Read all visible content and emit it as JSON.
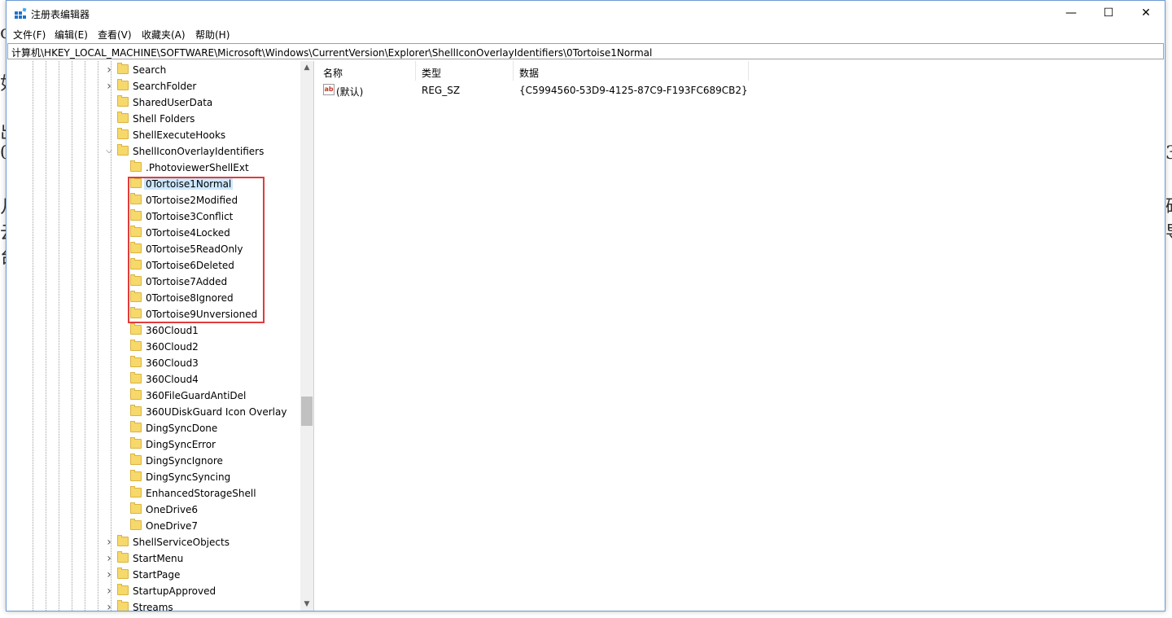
{
  "window": {
    "title": "注册表编辑器",
    "min_glyph": "—",
    "max_glyph": "☐",
    "close_glyph": "✕"
  },
  "menu": [
    "文件(F)",
    "编辑(E)",
    "查看(V)",
    "收藏夹(A)",
    "帮助(H)"
  ],
  "address": "计算机\\HKEY_LOCAL_MACHINE\\SOFTWARE\\Microsoft\\Windows\\CurrentVersion\\Explorer\\ShellIconOverlayIdentifiers\\0Tortoise1Normal",
  "tree": {
    "items": [
      {
        "label": "Search",
        "level": 1,
        "expander": "collapsed"
      },
      {
        "label": "SearchFolder",
        "level": 1,
        "expander": "collapsed"
      },
      {
        "label": "SharedUserData",
        "level": 1,
        "expander": "none"
      },
      {
        "label": "Shell Folders",
        "level": 1,
        "expander": "none"
      },
      {
        "label": "ShellExecuteHooks",
        "level": 1,
        "expander": "none"
      },
      {
        "label": "ShellIconOverlayIdentifiers",
        "level": 1,
        "expander": "expanded"
      },
      {
        "label": ".PhotoviewerShellExt",
        "level": 2,
        "expander": "none"
      },
      {
        "label": "0Tortoise1Normal",
        "level": 2,
        "expander": "none",
        "selected": true
      },
      {
        "label": "0Tortoise2Modified",
        "level": 2,
        "expander": "none"
      },
      {
        "label": "0Tortoise3Conflict",
        "level": 2,
        "expander": "none"
      },
      {
        "label": "0Tortoise4Locked",
        "level": 2,
        "expander": "none"
      },
      {
        "label": "0Tortoise5ReadOnly",
        "level": 2,
        "expander": "none"
      },
      {
        "label": "0Tortoise6Deleted",
        "level": 2,
        "expander": "none"
      },
      {
        "label": "0Tortoise7Added",
        "level": 2,
        "expander": "none"
      },
      {
        "label": "0Tortoise8Ignored",
        "level": 2,
        "expander": "none"
      },
      {
        "label": "0Tortoise9Unversioned",
        "level": 2,
        "expander": "none"
      },
      {
        "label": "360Cloud1",
        "level": 2,
        "expander": "none"
      },
      {
        "label": "360Cloud2",
        "level": 2,
        "expander": "none"
      },
      {
        "label": "360Cloud3",
        "level": 2,
        "expander": "none"
      },
      {
        "label": "360Cloud4",
        "level": 2,
        "expander": "none"
      },
      {
        "label": "360FileGuardAntiDel",
        "level": 2,
        "expander": "none"
      },
      {
        "label": "360UDiskGuard Icon Overlay",
        "level": 2,
        "expander": "none"
      },
      {
        "label": "DingSyncDone",
        "level": 2,
        "expander": "none"
      },
      {
        "label": "DingSyncError",
        "level": 2,
        "expander": "none"
      },
      {
        "label": "DingSyncIgnore",
        "level": 2,
        "expander": "none"
      },
      {
        "label": "DingSyncSyncing",
        "level": 2,
        "expander": "none"
      },
      {
        "label": "EnhancedStorageShell",
        "level": 2,
        "expander": "none"
      },
      {
        "label": "OneDrive6",
        "level": 2,
        "expander": "none"
      },
      {
        "label": "OneDrive7",
        "level": 2,
        "expander": "none"
      },
      {
        "label": "ShellServiceObjects",
        "level": 1,
        "expander": "collapsed"
      },
      {
        "label": "StartMenu",
        "level": 1,
        "expander": "collapsed"
      },
      {
        "label": "StartPage",
        "level": 1,
        "expander": "collapsed"
      },
      {
        "label": "StartupApproved",
        "level": 1,
        "expander": "collapsed"
      },
      {
        "label": "Streams",
        "level": 1,
        "expander": "collapsed"
      }
    ]
  },
  "list": {
    "columns": [
      "名称",
      "类型",
      "数据"
    ],
    "rows": [
      {
        "name": "(默认)",
        "type": "REG_SZ",
        "data": "{C5994560-53D9-4125-87C9-F193FC689CB2}"
      }
    ]
  },
  "colors": {
    "highlight_box": "#e03c3c",
    "selection": "#cce8ff",
    "folder": "#f6d86b"
  },
  "icons": {
    "app": "registry-editor-icon",
    "string_value": "ab-string-icon",
    "folder": "folder-icon"
  }
}
